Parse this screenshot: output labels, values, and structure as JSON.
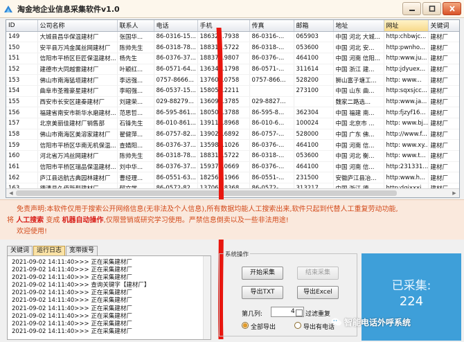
{
  "window": {
    "title": "淘金地企业信息采集软件v1.0",
    "buttons": [
      "minimize",
      "maximize",
      "close"
    ]
  },
  "grid": {
    "columns": [
      "ID",
      "公司名称",
      "联系人",
      "电话",
      "手机",
      "传真",
      "邮箱",
      "地址",
      "网址",
      "关键词"
    ],
    "sorted_column": "网址",
    "rows": [
      [
        "149",
        "大城县昌华保温建材厂",
        "张国华...",
        "86-0316-15...",
        "18632...7938",
        "86-0316-...",
        "065903",
        "中国 河北 大城...",
        "http:chbwjc...",
        "建材厂"
      ],
      [
        "150",
        "安平县万鸿金属丝网建材厂",
        "陈帅先生",
        "86-0318-78...",
        "18831...5722",
        "86-0318-...",
        "053600",
        "中国 河北 安...",
        "http:pwnho...",
        "建材厂"
      ],
      [
        "151",
        "信阳市平桥区巨匠保温建材...",
        "杨先生",
        "86-0376-37...",
        "18837...9807",
        "86-0376-...",
        "464100",
        "中国 河南 信阳...",
        "http:www.ju...",
        "建材厂"
      ],
      [
        "152",
        "建德市大同越雷建材厂",
        "叶颖红...",
        "86-0571-64...",
        "13634...1798",
        "86-0571-...",
        "311614",
        "中国 浙江 建...",
        "http:jdyuex...",
        "建材厂"
      ],
      [
        "153",
        "佛山市南海猛垣建材厂",
        "李远强...",
        "0757-8666...",
        "13760...0758",
        "0757-866...",
        "528200",
        "狮山富子塘工...",
        "http: www...",
        "建材厂"
      ],
      [
        "154",
        "曲阜市圣雅豪星建材厂",
        "李昭强...",
        "86-0537-15...",
        "15805...2211",
        "",
        "273100",
        "中国 山东 曲...",
        "http:sqxsjcc...",
        "建材厂"
      ],
      [
        "155",
        "西安市长安区建秦建材厂",
        "刘建荣...",
        "029-88279...",
        "13609...3785",
        "029-8827...",
        "",
        "魏家二路选... ",
        "http:www.ja...",
        "建材厂"
      ],
      [
        "156",
        "福建省南安市新华水磨建材...",
        "范思哲...",
        "86-595-861...",
        "18050...3788",
        "86-595-8...",
        "362304",
        "中国 福建 南...",
        "http:fjzyf16...",
        "建材厂"
      ],
      [
        "157",
        "北京美丽佳建材厂销售部",
        "石锋先生",
        "86-010-861...",
        "13911...8968",
        "86-010-6...",
        "100024",
        "中国 北京市 ...",
        "http: www.bj...",
        "建材厂"
      ],
      [
        "158",
        "佛山市南海区美溶家建材厂",
        "翟健萍...",
        "86-0757-82...",
        "13902...6892",
        "86-0757-...",
        "528000",
        "中国 广东 佛...",
        "http://www.f...",
        "建材厂"
      ],
      [
        "159",
        "信阳市平桥区华南无机保温...",
        "查婧阳...",
        "86-0376-37...",
        "13598...1026",
        "86-0376-...",
        "464100",
        "中国 河南 信...",
        "http: www.xy...",
        "建材厂"
      ],
      [
        "160",
        "河北省万鸿丝网建材厂",
        "陈帅先生",
        "86-0318-78...",
        "18831...5722",
        "86-0318-...",
        "053600",
        "中国 河北 衡...",
        "http: www.t...",
        "建材厂"
      ],
      [
        "161",
        "信阳市平桥区瑞品保温建材...",
        "刘中华...",
        "86-0376-37...",
        "15937...0669",
        "86-0376-...",
        "464100",
        "中国 河南 信...",
        "http:231331...",
        "建材厂"
      ],
      [
        "162",
        "庐江县远航古典园林建材厂",
        "曹经理...",
        "86-0551-63...",
        "18256...1966",
        "86-0551-...",
        "231500",
        "安徽庐江县冶...",
        "http:www.h...",
        "建材厂"
      ],
      [
        "163",
        "德清县久佰新型建材厂",
        "郁文学...",
        "86-0572-82...",
        "13706...8368",
        "86-0572-...",
        "313217",
        "中国 浙江 德...",
        "http:dqjxxxj...",
        "建材厂"
      ]
    ]
  },
  "disclaimer": {
    "line1": "免责声明:本软件仅用于搜索公开网络信息(无非法及个人信息),所有数据均能人工搜索出来,软件只起到代替人工重复劳动功能,",
    "line2_prefix": "将",
    "line2_hl1": "人工搜索",
    "line2_mid": "变成",
    "line2_hl2": "机器自动操作",
    "line2_suffix": ",仅限营销或研究学习使用。严禁信息倒卖以及一些非法用途!",
    "line3": "欢迎使用!"
  },
  "tabs": [
    {
      "label": "关键词",
      "active": false
    },
    {
      "label": "运行日志",
      "active": true
    },
    {
      "label": "宽带拨号",
      "active": false
    }
  ],
  "log": [
    "2021-09-02 14:11:40>>> 正在采集建材厂",
    "2021-09-02 14:11:40>>> 正在采集建材厂",
    "2021-09-02 14:11:40>>> 正在采集建材厂",
    "2021-09-02 14:11:40>>> 查询关键字【建材厂】",
    "2021-09-02 14:11:40>>> 正在采集建材厂",
    "2021-09-02 14:11:40>>> 正在采集建材厂",
    "2021-09-02 14:11:40>>> 正在采集建材厂",
    "2021-09-02 14:11:40>>> 正在采集建材厂",
    "2021-09-02 14:11:40>>> 正在采集建材厂",
    "2021-09-02 14:11:40>>> 正在采集建材厂"
  ],
  "ops": {
    "title": "系统操作",
    "start": "开始采集",
    "stop": "结束采集",
    "export_txt": "导出TXT",
    "export_excel": "导出Excel",
    "column_label": "第几列:",
    "column_value": "4",
    "filter_dup": "过滤重复",
    "filter_dup_checked": false,
    "export_all": "全部导出",
    "export_all_selected": true,
    "export_phone": "导出有电话",
    "export_phone_selected": false
  },
  "counter": {
    "label": "已采集:",
    "value": "224"
  },
  "watermark": {
    "text": "智能电话外呼系统"
  },
  "colors": {
    "accent_orange": "#e09a2b",
    "counter_blue": "#3e9fd9",
    "disclaimer_text": "#d34b1c",
    "annotation_red": "#e8160f"
  }
}
